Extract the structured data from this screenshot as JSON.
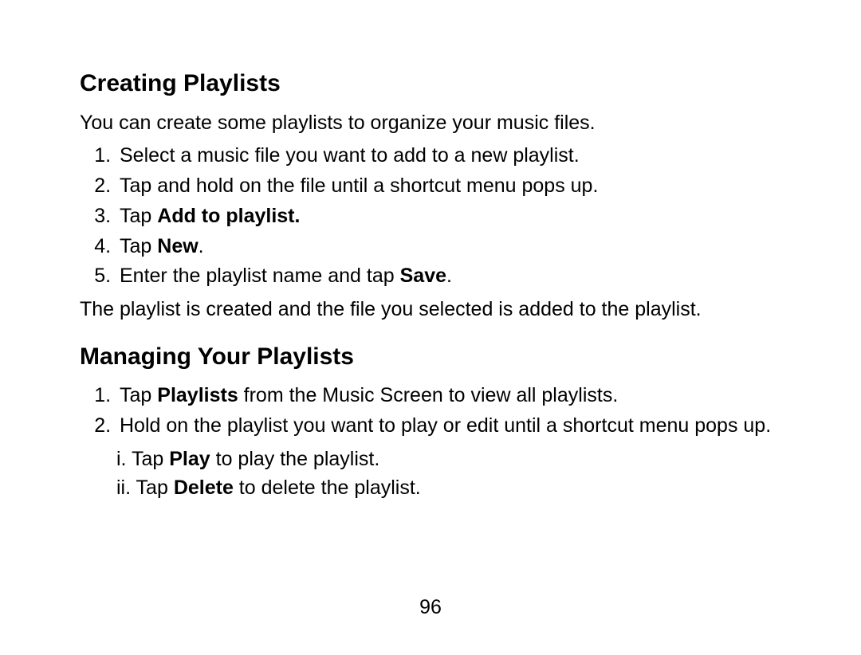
{
  "section1": {
    "heading": "Creating Playlists",
    "intro": "You can create some playlists to organize your music files.",
    "steps": {
      "s1": "Select a music file you want to add to a new playlist.",
      "s2": "Tap and hold on the file until a shortcut menu pops up.",
      "s3_pre": "Tap ",
      "s3_bold": "Add to playlist.",
      "s4_pre": "Tap ",
      "s4_bold": "New",
      "s4_post": ".",
      "s5_pre": "Enter the playlist name and tap ",
      "s5_bold": "Save",
      "s5_post": "."
    },
    "outro": "The playlist is created and the file you selected is added to the playlist."
  },
  "section2": {
    "heading": "Managing Your Playlists",
    "steps": {
      "s1_pre": "Tap ",
      "s1_bold": "Playlists",
      "s1_post": " from the Music Screen to view all playlists.",
      "s2": "Hold on the playlist you want to play or edit until a shortcut menu pops up.",
      "sub1_pre": "i. Tap ",
      "sub1_bold": "Play",
      "sub1_post": " to play the playlist.",
      "sub2_pre": "ii. Tap ",
      "sub2_bold": "Delete",
      "sub2_post": " to delete the playlist."
    }
  },
  "page_number": "96"
}
